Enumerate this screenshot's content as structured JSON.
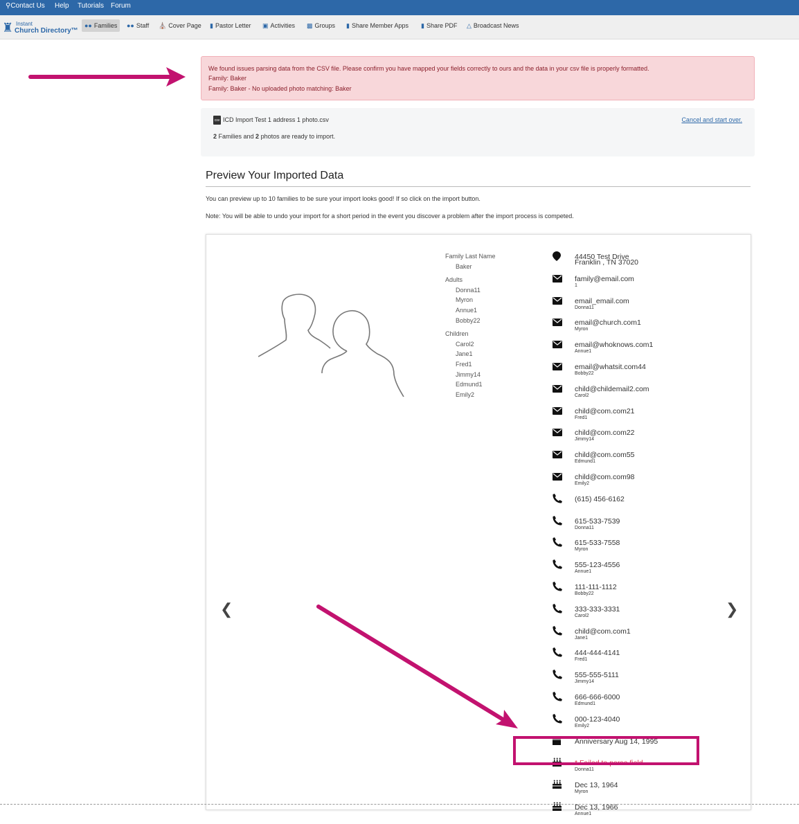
{
  "topbar": {
    "contact": "Contact Us",
    "help": "Help",
    "tutorials": "Tutorials",
    "forum": "Forum"
  },
  "logo": {
    "line1": "Instant",
    "line2": "Church Directory™"
  },
  "nav": [
    {
      "label": "Families",
      "icon": "users-icon"
    },
    {
      "label": "Staff",
      "icon": "staff-icon"
    },
    {
      "label": "Cover Page",
      "icon": "church-icon"
    },
    {
      "label": "Pastor Letter",
      "icon": "document-icon"
    },
    {
      "label": "Activities",
      "icon": "calendar-icon"
    },
    {
      "label": "Groups",
      "icon": "chat-icon"
    },
    {
      "label": "Share Member Apps",
      "icon": "phone-icon"
    },
    {
      "label": "Share PDF",
      "icon": "pdf-icon"
    },
    {
      "label": "Broadcast News",
      "icon": "bullhorn-icon"
    }
  ],
  "alert": {
    "line1": "We found issues parsing data from the CSV file. Please confirm you have mapped your fields correctly to ours and the data in your csv file is properly formatted.",
    "line2": "Family: Baker",
    "line3": "Family: Baker - No uploaded photo matching: Baker"
  },
  "file": {
    "name": "ICD Import Test 1 address 1 photo.csv",
    "icon_text": "csv",
    "families": "2",
    "photos": "2",
    "text1": " Families and ",
    "text2": " photos are ready to import.",
    "cancel": "Cancel and start over."
  },
  "preview": {
    "title": "Preview Your Imported Data",
    "p1": "You can preview up to 10 families to be sure your import looks good! If so click on the import button.",
    "p2": "Note: You will be able to undo your import for a short period in the event you discover a problem after the import process is competed."
  },
  "family": {
    "last_name_label": "Family Last Name",
    "last_name": "Baker",
    "adults_label": "Adults",
    "adults": [
      "Donna11",
      "Myron",
      "Annue1",
      "Bobby22"
    ],
    "children_label": "Children",
    "children": [
      "Carol2",
      "Jane1",
      "Fred1",
      "Jimmy14",
      "Edmund1",
      "Emily2"
    ]
  },
  "info": [
    {
      "icon": "map-marker-icon",
      "value": "44450 Test Drive",
      "sub": "Franklin , TN 37020"
    },
    {
      "icon": "envelope-icon",
      "value": "family@email.com",
      "sub": "1"
    },
    {
      "icon": "envelope-icon",
      "value": "email_email.com",
      "sub": "Donna11"
    },
    {
      "icon": "envelope-icon",
      "value": "email@church.com1",
      "sub": "Myron"
    },
    {
      "icon": "envelope-icon",
      "value": "email@whoknows.com1",
      "sub": "Annue1"
    },
    {
      "icon": "envelope-icon",
      "value": "email@whatsit.com44",
      "sub": "Bobby22"
    },
    {
      "icon": "envelope-icon",
      "value": "child@childemail2.com",
      "sub": "Carol2"
    },
    {
      "icon": "envelope-icon",
      "value": "child@com.com21",
      "sub": "Fred1"
    },
    {
      "icon": "envelope-icon",
      "value": "child@com.com22",
      "sub": "Jimmy14"
    },
    {
      "icon": "envelope-icon",
      "value": "child@com.com55",
      "sub": "Edmund1"
    },
    {
      "icon": "envelope-icon",
      "value": "child@com.com98",
      "sub": "Emily2"
    },
    {
      "icon": "phone-icon",
      "value": "(615) 456-6162",
      "sub": ""
    },
    {
      "icon": "phone-icon",
      "value": "615-533-7539",
      "sub": "Donna11"
    },
    {
      "icon": "phone-icon",
      "value": "615-533-7558",
      "sub": "Myron"
    },
    {
      "icon": "phone-icon",
      "value": "555-123-4556",
      "sub": "Annue1"
    },
    {
      "icon": "phone-icon",
      "value": "111-111-1112",
      "sub": "Bobby22"
    },
    {
      "icon": "phone-icon",
      "value": "333-333-3331",
      "sub": "Carol2"
    },
    {
      "icon": "phone-icon",
      "value": "child@com.com1",
      "sub": "Jane1"
    },
    {
      "icon": "phone-icon",
      "value": "444-444-4141",
      "sub": "Fred1"
    },
    {
      "icon": "phone-icon",
      "value": "555-555-5111",
      "sub": "Jimmy14"
    },
    {
      "icon": "phone-icon",
      "value": "666-666-6000",
      "sub": "Edmund1"
    },
    {
      "icon": "phone-icon",
      "value": "000-123-4040",
      "sub": "Emily2"
    },
    {
      "icon": "calendar-icon",
      "value": "Anniversary Aug 14, 1995",
      "sub": ""
    },
    {
      "icon": "birthday-cake-icon",
      "value": "* Failed to parse field.",
      "sub": "Donna11",
      "error": true
    },
    {
      "icon": "birthday-cake-icon",
      "value": "Dec 13, 1964",
      "sub": "Myron"
    },
    {
      "icon": "birthday-cake-icon",
      "value": "Dec 13, 1966",
      "sub": "Annue1"
    }
  ],
  "colors": {
    "brand": "#2d68a8",
    "annotation": "#c2126f",
    "error": "#d9304a",
    "alert_bg": "#f8d7da"
  }
}
